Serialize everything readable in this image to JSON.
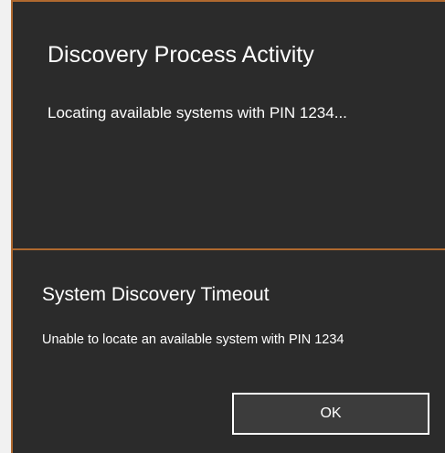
{
  "discovery_dialog": {
    "title": "Discovery Process Activity",
    "message": "Locating available systems with PIN 1234..."
  },
  "timeout_dialog": {
    "title": "System Discovery Timeout",
    "message": "Unable to locate an available system with PIN 1234",
    "ok_label": "OK"
  },
  "colors": {
    "dialog_background": "#2b2b2b",
    "accent_border": "#b0692f",
    "button_background": "#3c3c3c",
    "text": "#ffffff"
  }
}
